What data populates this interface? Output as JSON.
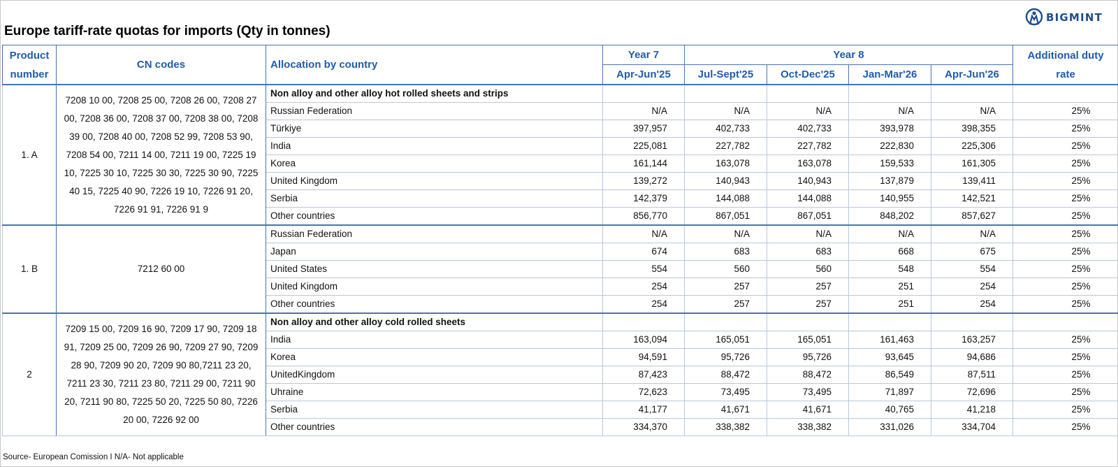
{
  "title": "Europe tariff-rate quotas for imports (Qty in tonnes)",
  "logo": {
    "text": "BIGMINT",
    "icon": "bigmint-logo-icon",
    "color": "#1f4d8f"
  },
  "header": {
    "product_number": "Product number",
    "cn_codes": "CN codes",
    "allocation": "Allocation by country",
    "year7": "Year 7",
    "year8": "Year 8",
    "additional": "Additional duty rate",
    "periods": [
      "Apr-Jun'25",
      "Jul-Sept'25",
      "Oct-Dec'25",
      "Jan-Mar'26",
      "Apr-Jun'26"
    ]
  },
  "groups": [
    {
      "product": "1. A",
      "cn_codes": "7208 10 00, 7208 25 00, 7208 26 00, 7208 27 00, 7208 36 00, 7208 37 00, 7208 38 00, 7208 39 00, 7208 40 00, 7208 52 99, 7208 53 90, 7208 54 00, 7211 14 00, 7211 19 00, 7225 19 10, 7225 30 10, 7225 30 30, 7225 30 90, 7225 40 15, 7225 40 90, 7226 19 10, 7226 91 20, 7226 91 91, 7226 91 9",
      "section": "Non alloy and other alloy hot rolled sheets and strips",
      "rows": [
        {
          "country": "Russian Federation",
          "values": [
            "N/A",
            "N/A",
            "N/A",
            "N/A",
            "N/A"
          ],
          "rate": "25%"
        },
        {
          "country": "Türkiye",
          "values": [
            "397,957",
            "402,733",
            "402,733",
            "393,978",
            "398,355"
          ],
          "rate": "25%"
        },
        {
          "country": "India",
          "values": [
            "225,081",
            "227,782",
            "227,782",
            "222,830",
            "225,306"
          ],
          "rate": "25%"
        },
        {
          "country": "Korea",
          "values": [
            "161,144",
            "163,078",
            "163,078",
            "159,533",
            "161,305"
          ],
          "rate": "25%"
        },
        {
          "country": "United Kingdom",
          "values": [
            "139,272",
            "140,943",
            "140,943",
            "137,879",
            "139,411"
          ],
          "rate": "25%"
        },
        {
          "country": "Serbia",
          "values": [
            "142,379",
            "144,088",
            "144,088",
            "140,955",
            "142,521"
          ],
          "rate": "25%"
        },
        {
          "country": "Other countries",
          "values": [
            "856,770",
            "867,051",
            "867,051",
            "848,202",
            "857,627"
          ],
          "rate": "25%"
        }
      ]
    },
    {
      "product": "1. B",
      "cn_codes": "7212 60 00",
      "section": "",
      "rows": [
        {
          "country": "Russian Federation",
          "values": [
            "N/A",
            "N/A",
            "N/A",
            "N/A",
            "N/A"
          ],
          "rate": "25%"
        },
        {
          "country": "Japan",
          "values": [
            "674",
            "683",
            "683",
            "668",
            "675"
          ],
          "rate": "25%"
        },
        {
          "country": "United States",
          "values": [
            "554",
            "560",
            "560",
            "548",
            "554"
          ],
          "rate": "25%"
        },
        {
          "country": "United Kingdom",
          "values": [
            "254",
            "257",
            "257",
            "251",
            "254"
          ],
          "rate": "25%"
        },
        {
          "country": "Other countries",
          "values": [
            "254",
            "257",
            "257",
            "251",
            "254"
          ],
          "rate": "25%"
        }
      ]
    },
    {
      "product": "2",
      "cn_codes": "7209 15 00, 7209 16 90, 7209 17 90, 7209 18 91, 7209 25 00, 7209 26 90, 7209 27 90, 7209 28 90, 7209 90 20, 7209 90 80,7211 23 20, 7211 23 30, 7211 23 80, 7211 29 00, 7211 90 20, 7211 90 80, 7225 50 20, 7225 50 80, 7226 20 00, 7226 92 00",
      "section": "Non alloy and other alloy cold rolled sheets",
      "rows": [
        {
          "country": "India",
          "values": [
            "163,094",
            "165,051",
            "165,051",
            "161,463",
            "163,257"
          ],
          "rate": "25%"
        },
        {
          "country": "Korea",
          "values": [
            "94,591",
            "95,726",
            "95,726",
            "93,645",
            "94,686"
          ],
          "rate": "25%"
        },
        {
          "country": "UnitedKingdom",
          "values": [
            "87,423",
            "88,472",
            "88,472",
            "86,549",
            "87,511"
          ],
          "rate": "25%"
        },
        {
          "country": "Uhraine",
          "values": [
            "72,623",
            "73,495",
            "73,495",
            "71,897",
            "72,696"
          ],
          "rate": "25%"
        },
        {
          "country": "Serbia",
          "values": [
            "41,177",
            "41,671",
            "41,671",
            "40,765",
            "41,218"
          ],
          "rate": "25%"
        },
        {
          "country": "Other countries",
          "values": [
            "334,370",
            "338,382",
            "338,382",
            "331,026",
            "334,704"
          ],
          "rate": "25%"
        }
      ]
    }
  ],
  "source": "Source- European Comission I N/A- Not applicable"
}
